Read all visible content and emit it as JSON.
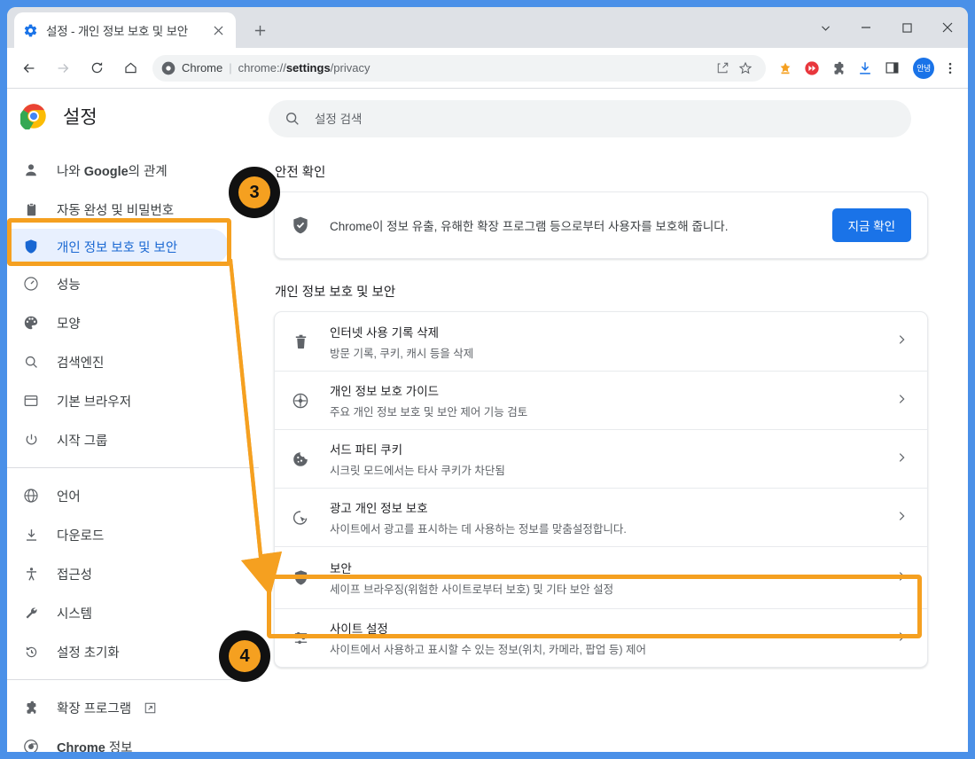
{
  "browser": {
    "tab": {
      "title": "설정 - 개인 정보 보호 및 보안",
      "favicon_icon": "gear-icon",
      "close_icon": "close-icon"
    },
    "new_tab_label": "+",
    "window_controls": {
      "tab_search": "chevron-down-icon",
      "minimize": "minimize-icon",
      "maximize": "maximize-icon",
      "close": "close-icon"
    },
    "omnibox": {
      "scheme_label": "Chrome",
      "separator": "|",
      "url_prefix": "chrome://",
      "url_bold": "settings",
      "url_suffix": "/privacy",
      "chrome_icon": "chrome-icon"
    },
    "omnibox_actions": [
      "share-icon",
      "bookmark-star-icon"
    ],
    "toolbar_icons": [
      "orange-extension-icon",
      "red-fast-forward-icon",
      "puzzle-extensions-icon",
      "download-icon",
      "side-panel-icon"
    ],
    "avatar_label": "안녕",
    "menu_icon": "three-dot-menu-icon"
  },
  "settings": {
    "title": "설정",
    "logo_icon": "chrome-logo-icon",
    "search": {
      "placeholder": "설정 검색",
      "value": "",
      "icon": "search-icon"
    }
  },
  "sidebar": {
    "items": [
      {
        "label_plain": "나와 ",
        "label_bold": "Google",
        "label_tail": "의 관계",
        "icon": "person-icon",
        "active": false
      },
      {
        "label": "자동 완성 및 비밀번호",
        "icon": "clipboard-icon",
        "active": false
      },
      {
        "label": "개인 정보 보호 및 보안",
        "icon": "shield-icon",
        "active": true
      },
      {
        "label": "성능",
        "icon": "speedometer-icon",
        "active": false
      },
      {
        "label": "모양",
        "icon": "palette-icon",
        "active": false
      },
      {
        "label": "검색엔진",
        "icon": "magnifier-icon",
        "active": false
      },
      {
        "label": "기본 브라우저",
        "icon": "browser-window-icon",
        "active": false
      },
      {
        "label": "시작 그룹",
        "icon": "power-icon",
        "active": false
      }
    ],
    "items2": [
      {
        "label": "언어",
        "icon": "globe-icon"
      },
      {
        "label": "다운로드",
        "icon": "download-icon"
      },
      {
        "label": "접근성",
        "icon": "accessibility-icon"
      },
      {
        "label": "시스템",
        "icon": "wrench-icon"
      },
      {
        "label": "설정 초기화",
        "icon": "history-reset-icon"
      }
    ],
    "items3": [
      {
        "label": "확장 프로그램",
        "icon": "puzzle-icon",
        "external_icon": "external-link-icon"
      },
      {
        "label_plain": "",
        "label_bold": "Chrome",
        "label_tail": " 정보",
        "icon": "chrome-circle-icon"
      }
    ]
  },
  "main": {
    "safety_check_title": "안전 확인",
    "safety_check": {
      "icon": "shield-check-icon",
      "text": "Chrome이 정보 유출, 유해한 확장 프로그램 등으로부터 사용자를 보호해 줍니다.",
      "button_label": "지금 확인"
    },
    "privacy_title": "개인 정보 보호 및 보안",
    "rows": [
      {
        "icon": "trash-icon",
        "title": "인터넷 사용 기록 삭제",
        "subtitle": "방문 기록, 쿠키, 캐시 등을 삭제",
        "arrow": "chevron-right-icon",
        "highlighted": false
      },
      {
        "icon": "guide-compass-icon",
        "title": "개인 정보 보호 가이드",
        "subtitle": "주요 개인 정보 보호 및 보안 제어 기능 검토",
        "arrow": "chevron-right-icon",
        "highlighted": false
      },
      {
        "icon": "cookie-icon",
        "title": "서드 파티 쿠키",
        "subtitle": "시크릿 모드에서는 타사 쿠키가 차단됨",
        "arrow": "chevron-right-icon",
        "highlighted": false
      },
      {
        "icon": "ad-privacy-icon",
        "title": "광고 개인 정보 보호",
        "subtitle": "사이트에서 광고를 표시하는 데 사용하는 정보를 맞춤설정합니다.",
        "arrow": "chevron-right-icon",
        "highlighted": false
      },
      {
        "icon": "shield-icon",
        "title": "보안",
        "subtitle": "세이프 브라우징(위험한 사이트로부터 보호) 및 기타 보안 설정",
        "arrow": "chevron-right-icon",
        "highlighted": true
      },
      {
        "icon": "sliders-icon",
        "title": "사이트 설정",
        "subtitle": "사이트에서 사용하고 표시할 수 있는 정보(위치, 카메라, 팝업 등) 제어",
        "arrow": "chevron-right-icon",
        "highlighted": false
      }
    ]
  },
  "annotations": {
    "accent_color": "#f5a020",
    "badges": [
      {
        "number": "3"
      },
      {
        "number": "4"
      }
    ],
    "arrow_icon": "down-arrow-annotation"
  }
}
